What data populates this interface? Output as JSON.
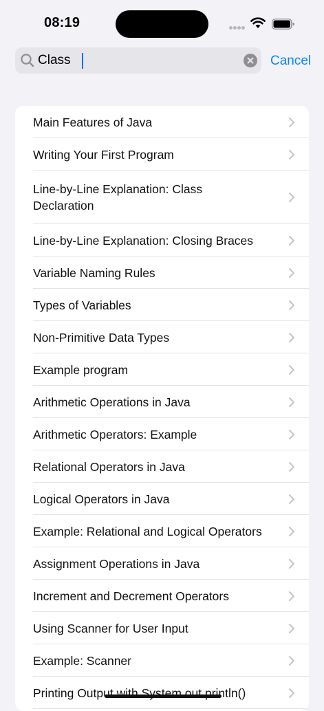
{
  "status_bar": {
    "time": "08:19"
  },
  "search": {
    "value": "Class",
    "cancel_label": "Cancel"
  },
  "icons": {
    "search": "magnifying-glass-icon",
    "clear": "x-circle-icon",
    "row_chevron": "chevron-right-icon",
    "wifi": "wifi-icon",
    "battery": "battery-icon"
  },
  "colors": {
    "accent": "#0A84FF",
    "background": "#F2F2F7",
    "card": "#FFFFFF",
    "separator": "#E3E3E8",
    "chevron": "#C4C4C7"
  },
  "results": [
    "Main Features of Java",
    "Writing Your First Program",
    "Line-by-Line Explanation: Class Declaration",
    "Line-by-Line Explanation: Closing Braces",
    "Variable Naming Rules",
    "Types of Variables",
    "Non-Primitive Data Types",
    "Example program",
    "Arithmetic Operations in Java",
    "Arithmetic Operators: Example",
    "Relational Operators in Java",
    "Logical Operators in Java",
    "Example: Relational and Logical Operators",
    "Assignment Operations in Java",
    "Increment and Decrement Operators",
    "Using Scanner for User Input",
    "Example: Scanner",
    "Printing Output with System.out.println()"
  ]
}
